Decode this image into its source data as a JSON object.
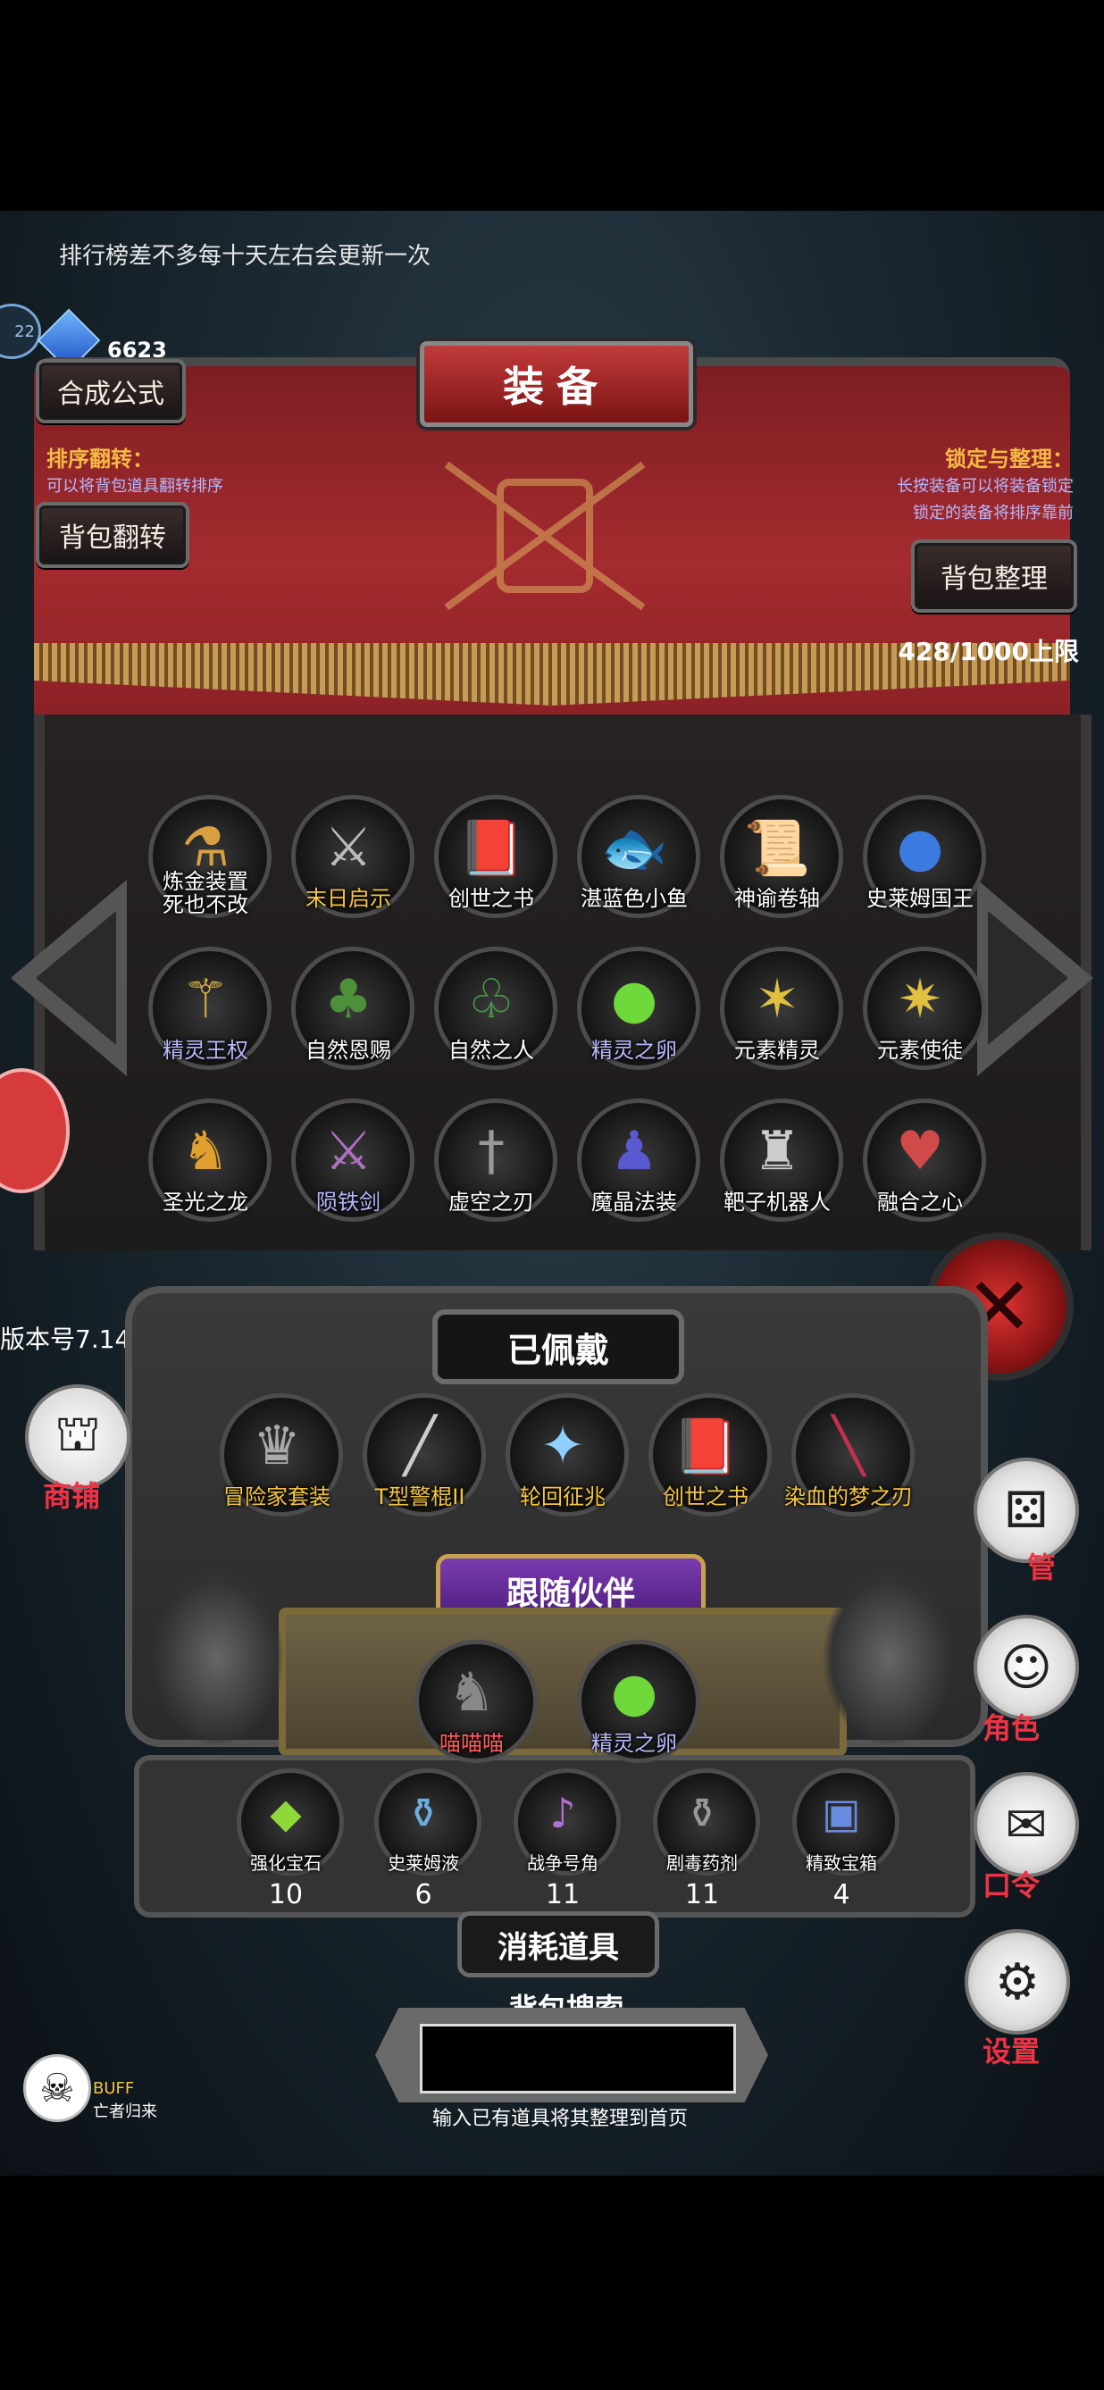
{
  "notice": "排行榜差不多每十天左右会更新一次",
  "currency": {
    "icon": "blue-crystal-icon",
    "amount": "6623"
  },
  "level_badge": "22",
  "buttons": {
    "formula": "合成公式",
    "bag_flip": "背包翻转",
    "bag_sort": "背包整理"
  },
  "title": "装备",
  "hints": {
    "sort_flip_title": "排序翻转：",
    "sort_flip_text": "可以将背包道具翻转排序",
    "lock_title": "锁定与整理：",
    "lock_text_1": "长按装备可以将装备锁定",
    "lock_text_2": "锁定的装备将排序靠前"
  },
  "capacity": "428/1000上限",
  "inventory": [
    {
      "label": "炼金装置\n死也不改",
      "icon": "alchemy-device-icon"
    },
    {
      "label": "末日启示",
      "icon": "doom-scythe-icon"
    },
    {
      "label": "创世之书",
      "icon": "genesis-book-icon"
    },
    {
      "label": "湛蓝色小鱼",
      "icon": "blue-fish-icon"
    },
    {
      "label": "神谕卷轴",
      "icon": "oracle-scroll-icon"
    },
    {
      "label": "史莱姆国王",
      "icon": "slime-king-icon"
    },
    {
      "label": "精灵王权",
      "icon": "elf-scepter-icon"
    },
    {
      "label": "自然恩赐",
      "icon": "nature-gift-icon"
    },
    {
      "label": "自然之人",
      "icon": "nature-man-icon"
    },
    {
      "label": "精灵之卵",
      "icon": "elf-egg-icon"
    },
    {
      "label": "元素精灵",
      "icon": "element-spirit-icon"
    },
    {
      "label": "元素使徒",
      "icon": "element-apostle-icon"
    },
    {
      "label": "圣光之龙",
      "icon": "holy-dragon-icon"
    },
    {
      "label": "陨铁剑",
      "icon": "meteor-sword-icon"
    },
    {
      "label": "虚空之刃",
      "icon": "void-blade-icon"
    },
    {
      "label": "魔晶法装",
      "icon": "wizard-robe-icon"
    },
    {
      "label": "靶子机器人",
      "icon": "target-robot-icon"
    },
    {
      "label": "融合之心",
      "icon": "fusion-heart-icon"
    }
  ],
  "equipped_title": "已佩戴",
  "equipped": [
    {
      "label": "冒险家套装",
      "icon": "adventurer-set-icon"
    },
    {
      "label": "T型警棍II",
      "icon": "baton-icon"
    },
    {
      "label": "轮回征兆",
      "icon": "reincarnation-staff-icon"
    },
    {
      "label": "创世之书",
      "icon": "genesis-book-icon"
    },
    {
      "label": "染血的梦之刃",
      "icon": "bloody-dream-blade-icon"
    }
  ],
  "companion_title": "跟随伙伴",
  "companions": [
    {
      "label": "喵喵喵",
      "icon": "cat-warrior-icon"
    },
    {
      "label": "精灵之卵",
      "icon": "elf-egg-icon"
    }
  ],
  "consumables_title": "消耗道具",
  "consumables": [
    {
      "label": "强化宝石",
      "count": "10",
      "icon": "enhance-gem-icon"
    },
    {
      "label": "史莱姆液",
      "count": "6",
      "icon": "slime-potion-icon"
    },
    {
      "label": "战争号角",
      "count": "11",
      "icon": "war-horn-icon"
    },
    {
      "label": "剧毒药剂",
      "count": "11",
      "icon": "poison-potion-icon"
    },
    {
      "label": "精致宝箱",
      "count": "4",
      "icon": "treasure-chest-icon"
    }
  ],
  "search": {
    "title": "背包搜索",
    "placeholder": "",
    "hint": "输入已有道具将其整理到首页"
  },
  "version": "版本号7.14",
  "side_menu": {
    "shop": "商铺",
    "butler": "管",
    "role": "角色",
    "code": "口令",
    "settings": "设置"
  },
  "buff": {
    "line1": "BUFF",
    "line2": "亡者归来"
  }
}
